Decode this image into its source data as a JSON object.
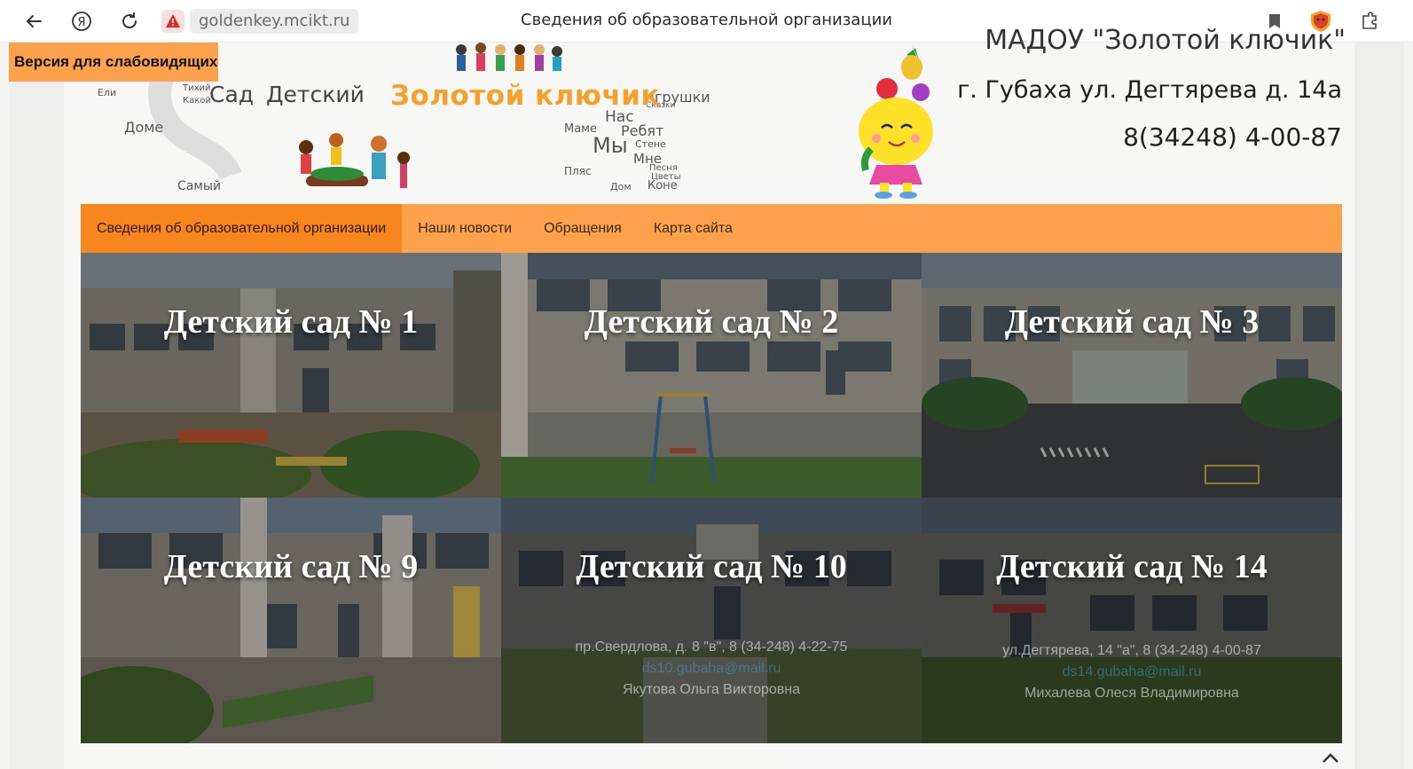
{
  "browser": {
    "url": "goldenkey.mcikt.ru",
    "tab_title": "Сведения об образовательной организации"
  },
  "accessibility": {
    "label": "Версия для слабовидящих"
  },
  "header": {
    "logo_title": "Золотой ключик",
    "org_name": "МАДОУ \"Золотой ключик\"",
    "address": "г. Губаха ул. Дегтярева д. 14а",
    "phone": "8(34248) 4-00-87",
    "word_cloud": [
      "Сад",
      "Детский",
      "Доме",
      "Самый",
      "Игрушки",
      "Нас",
      "Маме",
      "Ребят",
      "Мы",
      "Мне",
      "Стене",
      "Пляс",
      "Коне",
      "Дом",
      "Ели",
      "Тихий",
      "Какой",
      "Сказки",
      "Песня",
      "Цветы"
    ]
  },
  "menu": {
    "items": [
      {
        "label": "Сведения об образовательной организации",
        "active": true
      },
      {
        "label": "Наши новости",
        "active": false
      },
      {
        "label": "Обращения",
        "active": false
      },
      {
        "label": "Карта сайта",
        "active": false
      }
    ]
  },
  "tiles": [
    {
      "title": "Детский сад № 1"
    },
    {
      "title": "Детский сад № 2"
    },
    {
      "title": "Детский сад  № 3"
    },
    {
      "title": "Детский сад № 9"
    },
    {
      "title": "Детский сад № 10",
      "info": "пр.Свердлова, д. 8 \"в\", 8 (34-248) 4-22-75",
      "email": "ds10.gubaha@mail.ru",
      "person": "Якутова Ольга Викторовна"
    },
    {
      "title": "Детский сад № 14",
      "info": "ул.Дегтярева, 14 \"а\", 8 (34-248) 4-00-87",
      "email": "ds14.gubaha@mail.ru",
      "person": "Михалева Олеся Владимировна"
    }
  ],
  "colors": {
    "accent": "#fda24c",
    "accent_active": "#f7861e",
    "logo": "#f5a02a"
  }
}
